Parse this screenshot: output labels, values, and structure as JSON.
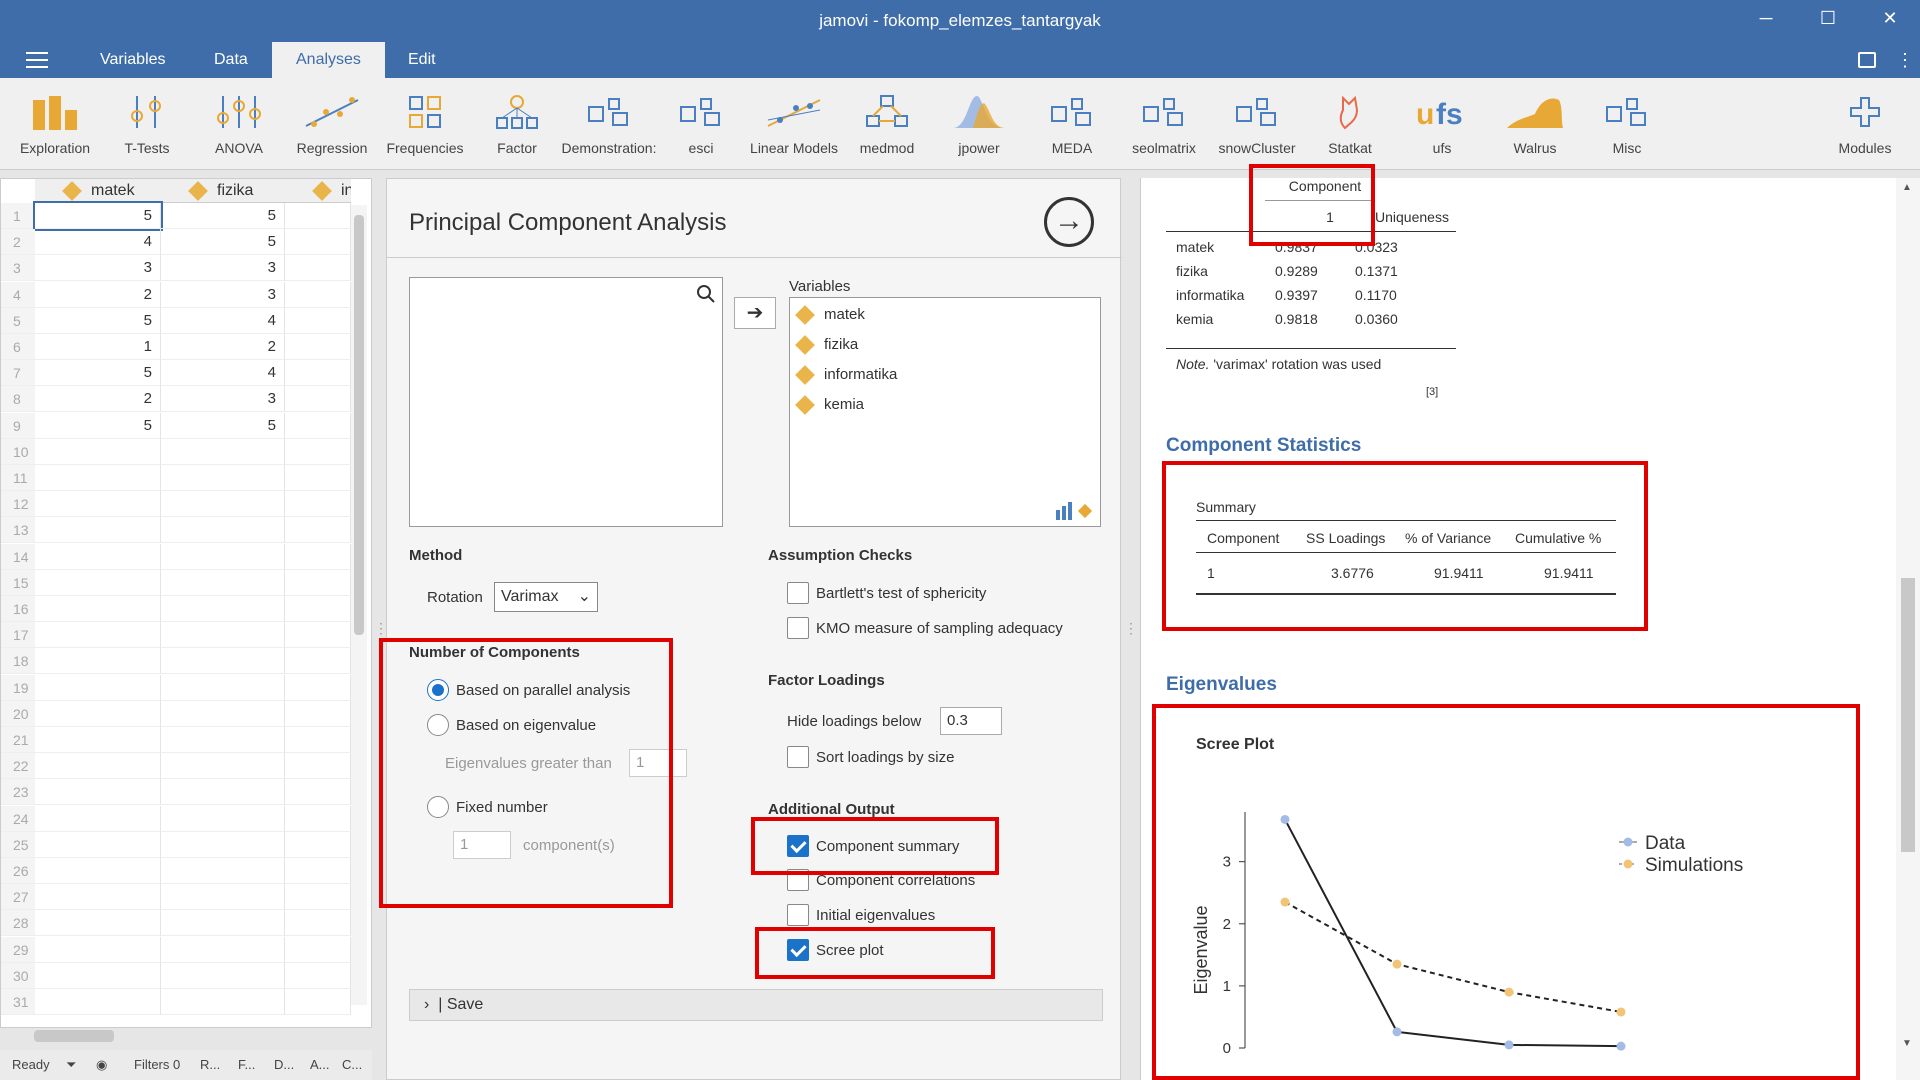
{
  "window": {
    "title": "jamovi - fokomp_elemzes_tantargyak",
    "minimize": "─",
    "maximize": "☐",
    "close": "✕"
  },
  "tabs": [
    {
      "label": "Variables"
    },
    {
      "label": "Data"
    },
    {
      "label": "Analyses"
    },
    {
      "label": "Edit"
    }
  ],
  "toolbar": [
    "Exploration",
    "T-Tests",
    "ANOVA",
    "Regression",
    "Frequencies",
    "Factor",
    "Demonstration:",
    "esci",
    "Linear Models",
    "medmod",
    "jpower",
    "MEDA",
    "seolmatrix",
    "snowCluster",
    "Statkat",
    "ufs",
    "Walrus",
    "Misc"
  ],
  "modules_label": "Modules",
  "sheet": {
    "columns": [
      "matek",
      "fizika",
      "informa"
    ],
    "rows": [
      [
        "5",
        "5"
      ],
      [
        "4",
        "5"
      ],
      [
        "3",
        "3"
      ],
      [
        "2",
        "3"
      ],
      [
        "5",
        "4"
      ],
      [
        "1",
        "2"
      ],
      [
        "5",
        "4"
      ],
      [
        "2",
        "3"
      ],
      [
        "5",
        "5"
      ]
    ],
    "row_numbers": [
      "1",
      "2",
      "3",
      "4",
      "5",
      "6",
      "7",
      "8",
      "9",
      "10",
      "11",
      "12",
      "13",
      "14",
      "15",
      "16",
      "17",
      "18",
      "19",
      "20",
      "21",
      "22",
      "23",
      "24",
      "25",
      "26",
      "27",
      "28",
      "29",
      "30",
      "31"
    ]
  },
  "status": {
    "ready": "Ready",
    "filters": "Filters 0",
    "r": "R...",
    "f": "F...",
    "d": "D...",
    "a": "A...",
    "c": "C..."
  },
  "analysis": {
    "title": "Principal Component Analysis",
    "arrow": "→",
    "variables_label": "Variables",
    "variables": [
      "matek",
      "fizika",
      "informatika",
      "kemia"
    ],
    "method": {
      "heading": "Method",
      "rotation_label": "Rotation",
      "rotation_value": "Varimax"
    },
    "ncomp": {
      "heading": "Number of Components",
      "parallel": "Based on parallel analysis",
      "eigen": "Based on eigenvalue",
      "eigen_gt_label": "Eigenvalues greater than",
      "eigen_gt_value": "1",
      "fixed": "Fixed number",
      "fixed_value": "1",
      "fixed_unit": "component(s)"
    },
    "assumption": {
      "heading": "Assumption Checks",
      "bartlett": "Bartlett's test of sphericity",
      "kmo": "KMO measure of sampling adequacy"
    },
    "loadings": {
      "heading": "Factor Loadings",
      "hide_label": "Hide loadings below",
      "hide_value": "0.3",
      "sort": "Sort loadings by size"
    },
    "additional": {
      "heading": "Additional Output",
      "summary": "Component summary",
      "correlations": "Component correlations",
      "initial": "Initial eigenvalues",
      "scree": "Scree plot"
    },
    "save": "Save"
  },
  "results": {
    "loadings_table": {
      "component_header": "Component",
      "component_num": "1",
      "uniqueness_header": "Uniqueness",
      "rows": [
        [
          "matek",
          "0.9837",
          "0.0323"
        ],
        [
          "fizika",
          "0.9289",
          "0.1371"
        ],
        [
          "informatika",
          "0.9397",
          "0.1170"
        ],
        [
          "kemia",
          "0.9818",
          "0.0360"
        ]
      ],
      "note_prefix": "Note.",
      "note_text": "'varimax' rotation was used",
      "ref": "[3]"
    },
    "comp_stats": {
      "heading": "Component Statistics",
      "summary_label": "Summary",
      "headers": [
        "Component",
        "SS Loadings",
        "% of Variance",
        "Cumulative %"
      ],
      "row": [
        "1",
        "3.6776",
        "91.9411",
        "91.9411"
      ]
    },
    "eigen": {
      "heading": "Eigenvalues",
      "plot_title": "Scree Plot"
    }
  },
  "chart_data": {
    "type": "line",
    "title": "Scree Plot",
    "ylabel": "Eigenvalue",
    "xlabel": "",
    "x": [
      1,
      2,
      3,
      4
    ],
    "ylim": [
      0,
      3.8
    ],
    "yticks": [
      0,
      1,
      2,
      3
    ],
    "legend_position": "top-right",
    "series": [
      {
        "name": "Data",
        "values": [
          3.68,
          0.26,
          0.05,
          0.03
        ],
        "color": "#a3bce6",
        "line": "solid"
      },
      {
        "name": "Simulations",
        "values": [
          2.35,
          1.35,
          0.9,
          0.58
        ],
        "color": "#f2c476",
        "line": "dashed"
      }
    ]
  }
}
